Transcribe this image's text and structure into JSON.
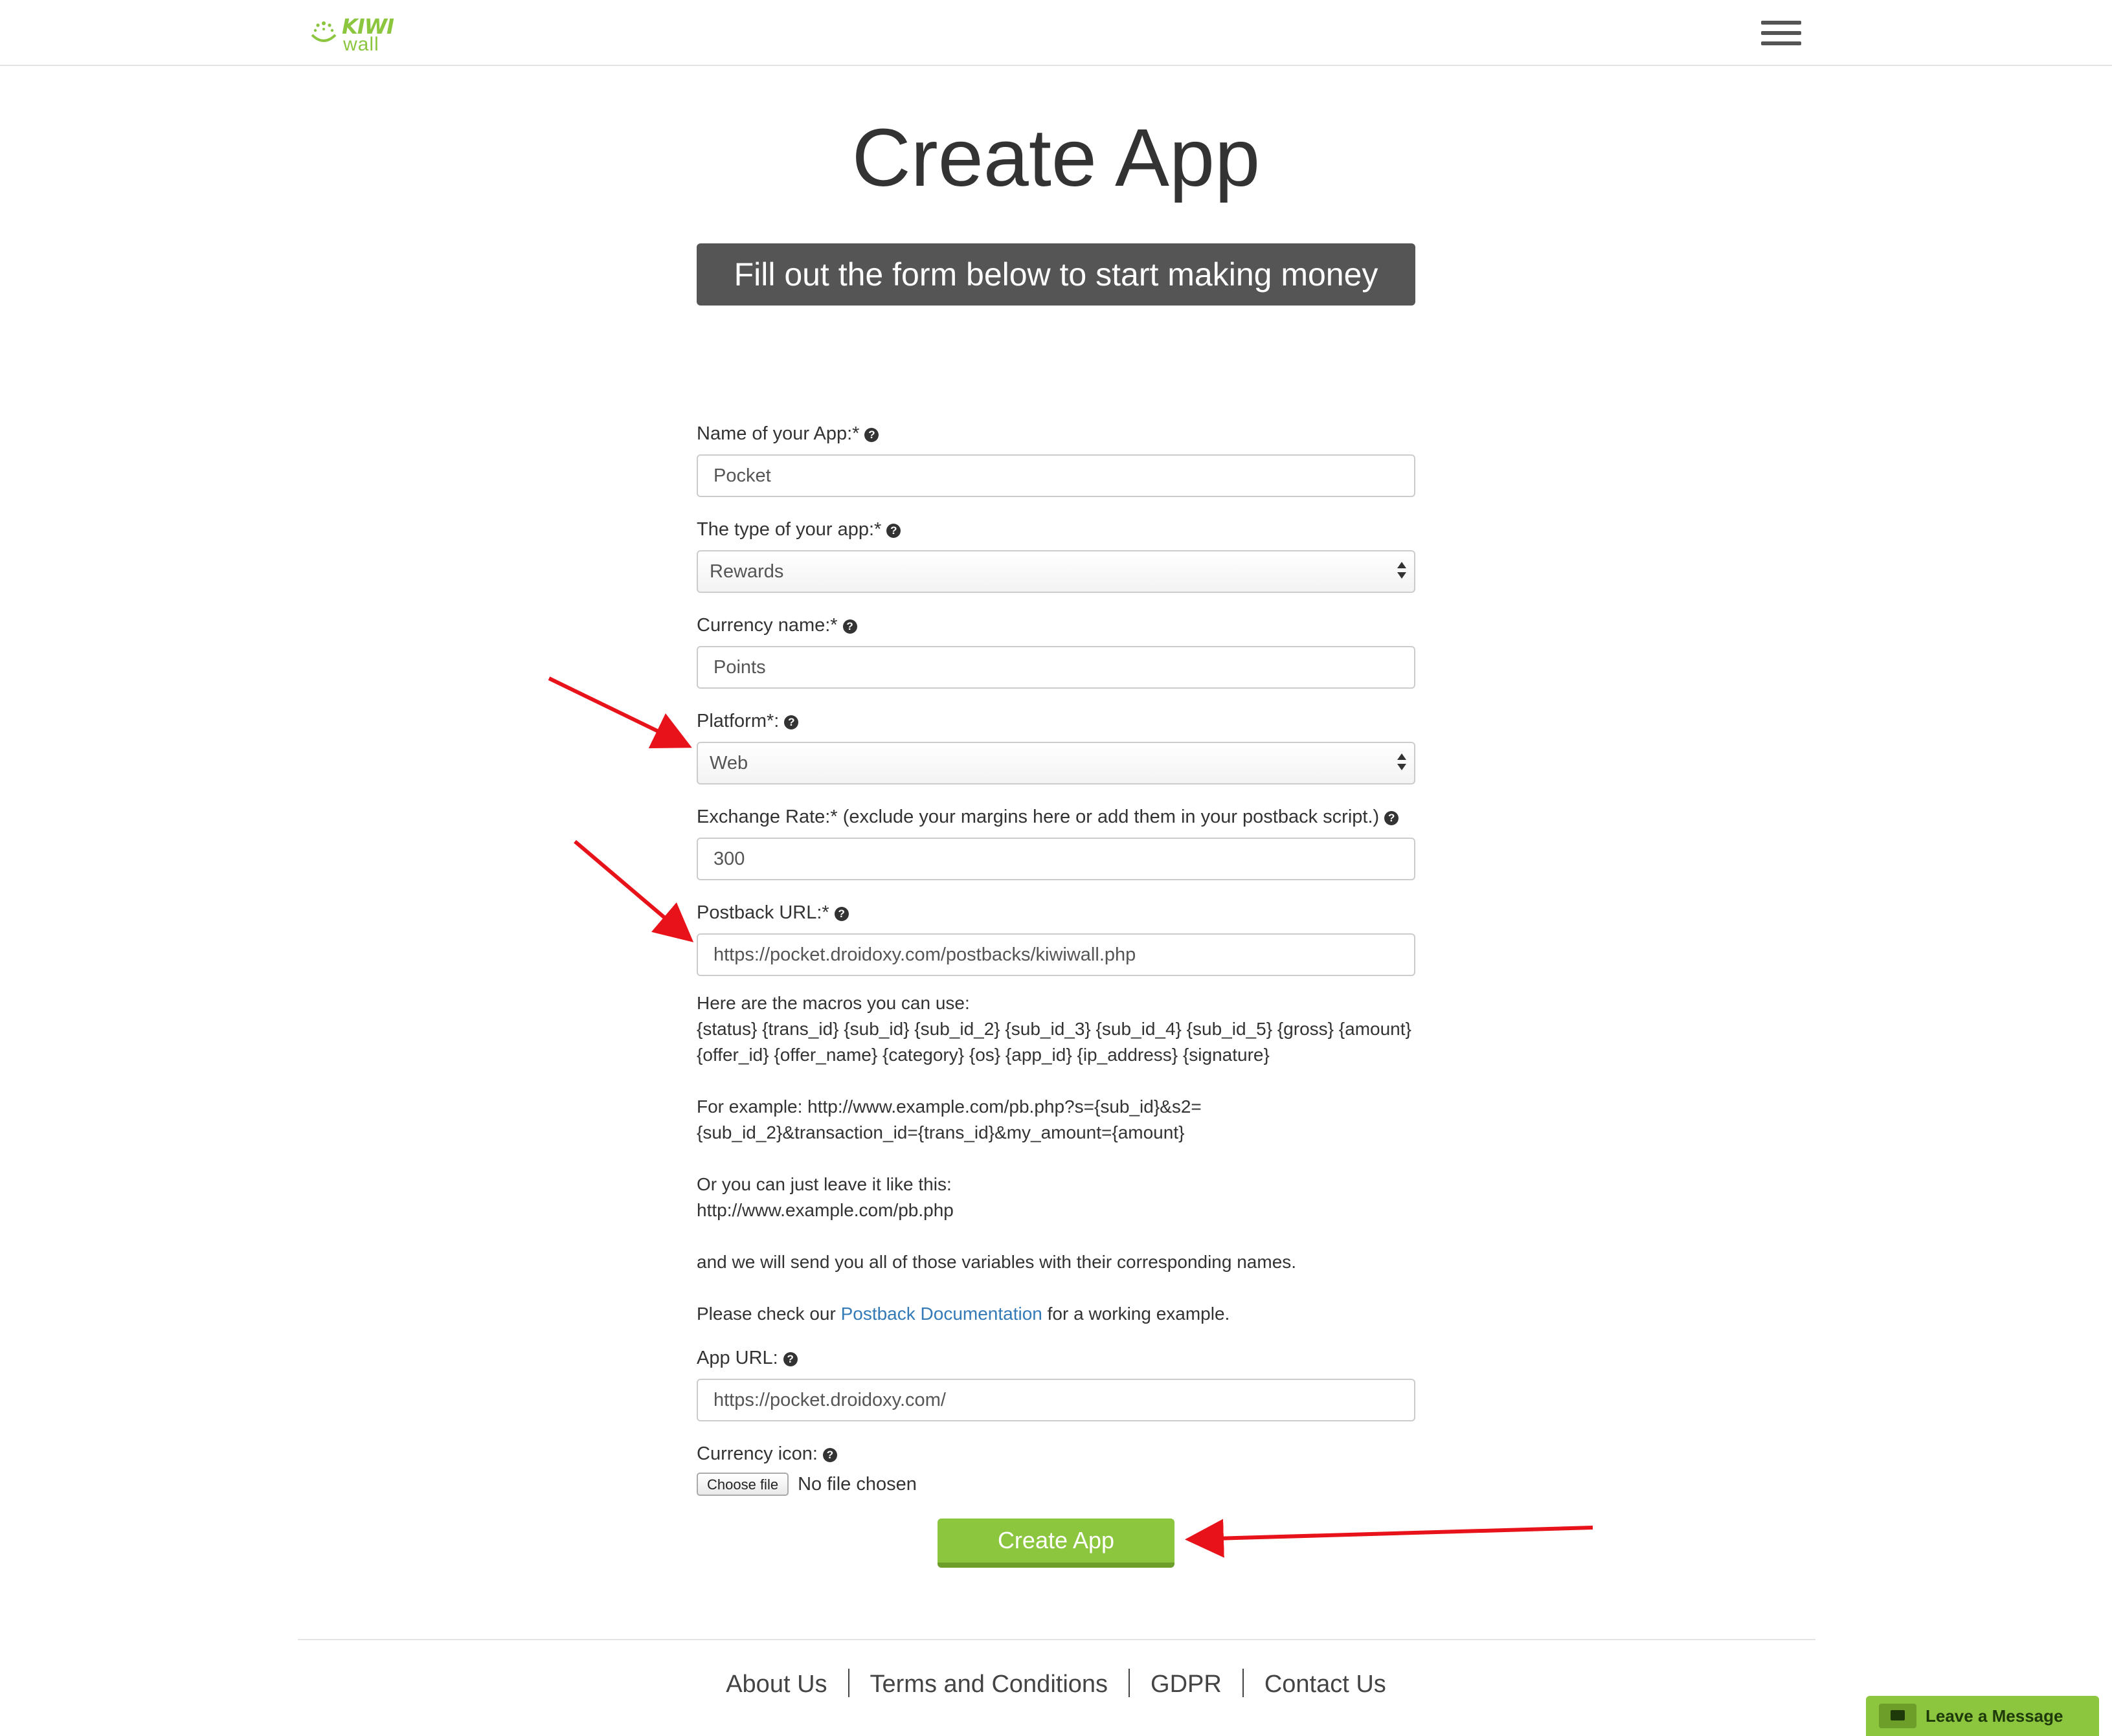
{
  "header": {
    "logo_top": "KIWI",
    "logo_bottom": "wall"
  },
  "page": {
    "title": "Create App",
    "banner": "Fill out the form below to start making money"
  },
  "form": {
    "app_name": {
      "label": "Name of your App:*",
      "value": "Pocket"
    },
    "app_type": {
      "label": "The type of your app:*",
      "value": "Rewards"
    },
    "currency_name": {
      "label": "Currency name:*",
      "value": "Points"
    },
    "platform": {
      "label": "Platform*:",
      "value": "Web"
    },
    "exchange_rate": {
      "label": "Exchange Rate:* (exclude your margins here or add them in your postback script.)",
      "value": "300"
    },
    "postback_url": {
      "label": "Postback URL:*",
      "value": "https://pocket.droidoxy.com/postbacks/kiwiwall.php"
    },
    "macros": {
      "heading": "Here are the macros you can use:",
      "line1": "{status} {trans_id} {sub_id} {sub_id_2} {sub_id_3} {sub_id_4} {sub_id_5} {gross} {amount}",
      "line2": "{offer_id} {offer_name} {category} {os} {app_id} {ip_address} {signature}",
      "example_line1": "For example: http://www.example.com/pb.php?s={sub_id}&s2=",
      "example_line2": "{sub_id_2}&transaction_id={trans_id}&my_amount={amount}",
      "leave_heading": "Or you can just leave it like this:",
      "leave_url": "http://www.example.com/pb.php",
      "send_note": "and we will send you all of those variables with their corresponding names.",
      "check_prefix": "Please check our ",
      "check_link": "Postback Documentation",
      "check_suffix": " for a working example."
    },
    "app_url": {
      "label": "App URL:",
      "value": "https://pocket.droidoxy.com/"
    },
    "currency_icon": {
      "label": "Currency icon:",
      "button": "Choose file",
      "status": "No file chosen"
    },
    "help_glyph": "?",
    "submit_label": "Create App"
  },
  "footer": {
    "links": [
      "About Us",
      "Terms and Conditions",
      "GDPR",
      "Contact Us"
    ]
  },
  "chat_widget": {
    "label": "Leave a Message"
  },
  "colors": {
    "brand_green": "#8cc63f",
    "banner_bg": "#555555",
    "link_blue": "#337ab7",
    "annotation_red": "#e8131a"
  }
}
